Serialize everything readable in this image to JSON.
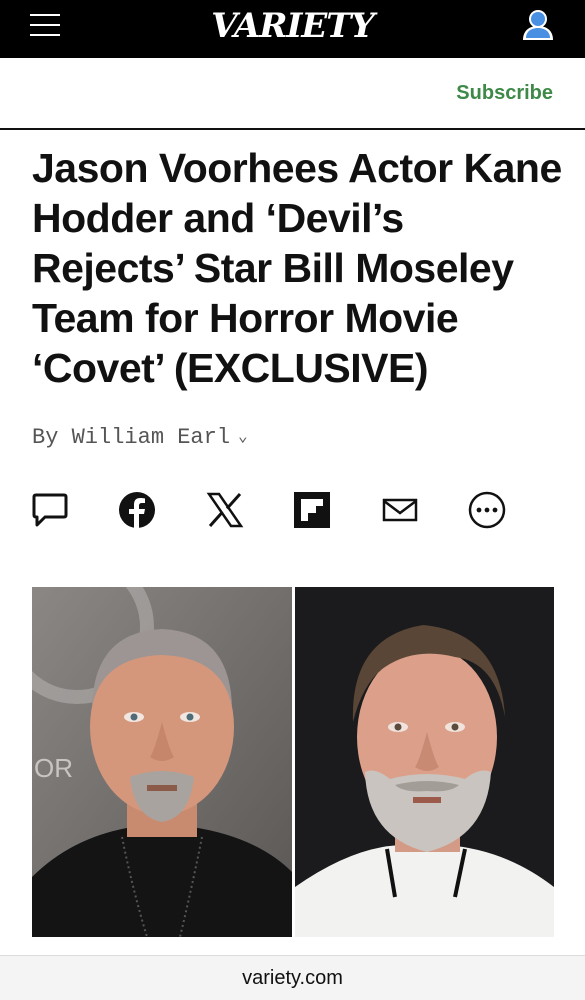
{
  "header": {
    "menu_icon": "hamburger-menu-icon",
    "logo_text": "VARIETY",
    "account_icon": "user-account-icon"
  },
  "subheader": {
    "subscribe_label": "Subscribe",
    "subscribe_color": "#3e8948"
  },
  "article": {
    "headline": "Jason Voorhees Actor Kane Hodder and ‘Devil’s Rejects’ Star Bill Moseley Team for Horror Movie ‘Covet’ (EXCLUSIVE)",
    "byline": "By William Earl",
    "byline_icon": "chevron-down-icon",
    "share_icons": [
      "comment-icon",
      "facebook-icon",
      "x-icon",
      "flipboard-icon",
      "email-icon",
      "more-icon"
    ]
  },
  "photos": [
    {
      "name": "left-portrait",
      "description_icon": "portrait-photo"
    },
    {
      "name": "right-portrait",
      "description_icon": "portrait-photo"
    }
  ],
  "browser": {
    "url": "variety.com"
  }
}
